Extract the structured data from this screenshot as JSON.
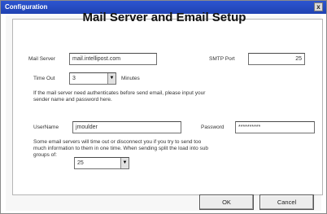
{
  "window": {
    "title": "Configuration",
    "close_glyph": "x"
  },
  "heading": "Mail Server and Email Setup",
  "mail_server": {
    "label": "Mail Server",
    "value": "mail.intellipost.com"
  },
  "smtp_port": {
    "label": "SMTP Port",
    "value": "25"
  },
  "time_out": {
    "label": "Time Out",
    "value": "3",
    "unit": "Minutes"
  },
  "auth_note": {
    "line1": "If the mail server need authenticates before send email, please input your",
    "line2": "sender name and password here."
  },
  "username": {
    "label": "UserName",
    "value": "jmoulder"
  },
  "password": {
    "label": "Password",
    "value": "**********"
  },
  "split_note": {
    "line1": "Some email servers will time out or disconnect you if you try to send too",
    "line2": "much information to them in one time. When sending split the load into sub",
    "line3": "groups of:"
  },
  "groups_of": {
    "value": "25"
  },
  "buttons": {
    "ok": "OK",
    "cancel": "Cancel"
  }
}
